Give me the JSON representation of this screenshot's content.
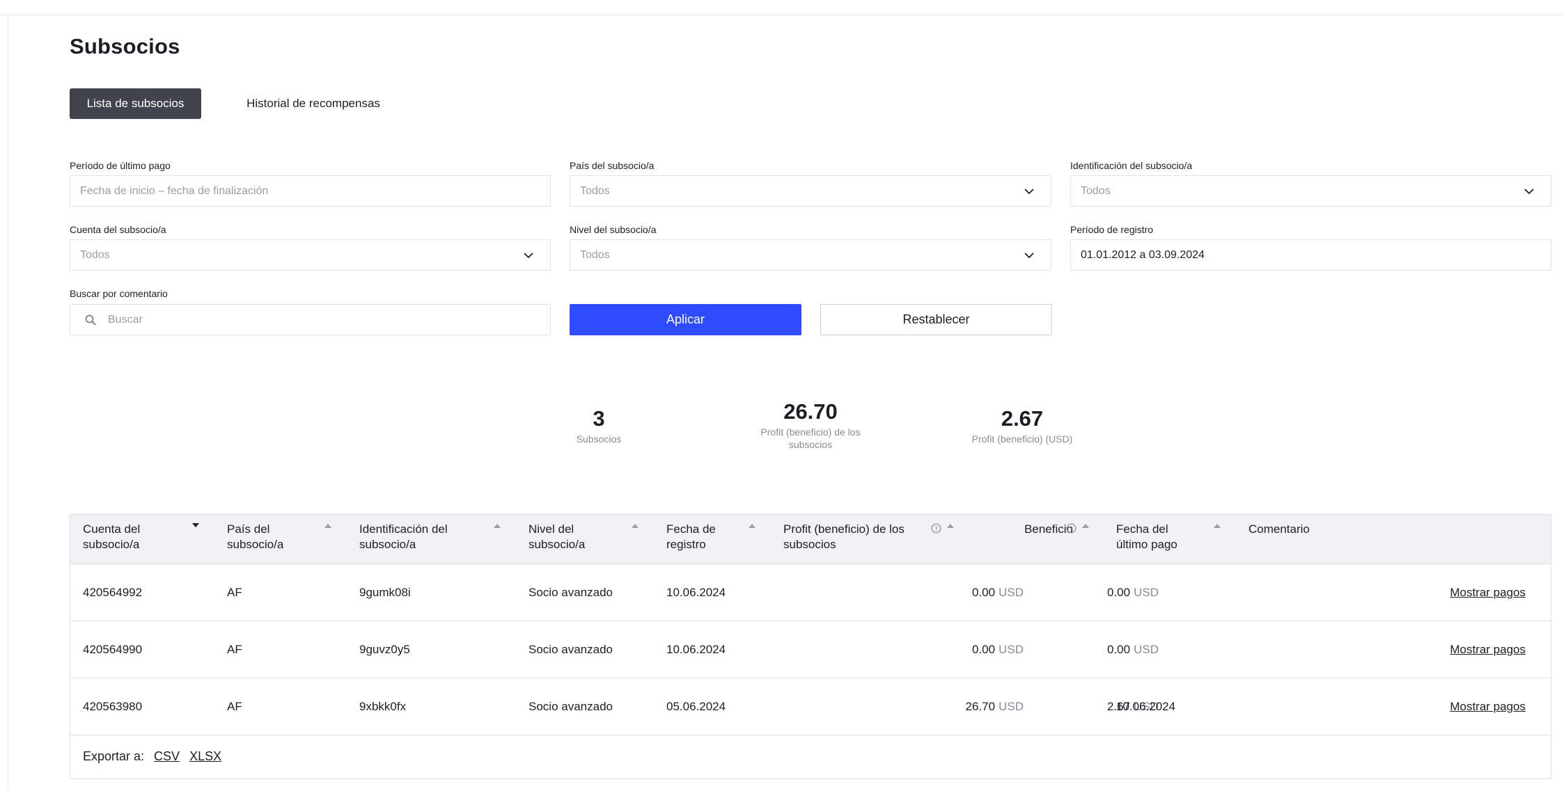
{
  "page": {
    "title": "Subsocios"
  },
  "tabs": [
    {
      "label": "Lista de subsocios",
      "active": true
    },
    {
      "label": "Historial de recompensas",
      "active": false
    }
  ],
  "filters": {
    "last_payment": {
      "label": "Período de último pago",
      "placeholder": "Fecha de inicio – fecha de finalización"
    },
    "country": {
      "label": "País del subsocio/a",
      "value": "Todos"
    },
    "identification": {
      "label": "Identificación del subsocio/a",
      "value": "Todos"
    },
    "account": {
      "label": "Cuenta del subsocio/a",
      "value": "Todos"
    },
    "level": {
      "label": "Nivel del subsocio/a",
      "value": "Todos"
    },
    "registration": {
      "label": "Período de registro",
      "value": "01.01.2012 a 03.09.2024"
    },
    "comment_search": {
      "label": "Buscar por comentario",
      "placeholder": "Buscar"
    }
  },
  "buttons": {
    "apply": "Aplicar",
    "reset": "Restablecer"
  },
  "stats": [
    {
      "value": "3",
      "label": "Subsocios"
    },
    {
      "value": "26.70",
      "label": "Profit (beneficio) de los subsocios"
    },
    {
      "value": "2.67",
      "label": "Profit (beneficio) (USD)"
    }
  ],
  "table": {
    "columns": [
      "Cuenta del subsocio/a",
      "País del subsocio/a",
      "Identificación del subsocio/a",
      "Nivel del subsocio/a",
      "Fecha de registro",
      "Profit (beneficio) de los subsocios",
      "Beneficio",
      "Fecha del último pago",
      "Comentario"
    ],
    "rows": [
      {
        "account": "420564992",
        "country": "AF",
        "id": "9gumk08i",
        "level": "Socio avanzado",
        "registered": "10.06.2024",
        "sub_profit": "0.00",
        "profit": "0.00",
        "last_payment": "",
        "comment": ""
      },
      {
        "account": "420564990",
        "country": "AF",
        "id": "9guvz0y5",
        "level": "Socio avanzado",
        "registered": "10.06.2024",
        "sub_profit": "0.00",
        "profit": "0.00",
        "last_payment": "",
        "comment": ""
      },
      {
        "account": "420563980",
        "country": "AF",
        "id": "9xbkk0fx",
        "level": "Socio avanzado",
        "registered": "05.06.2024",
        "sub_profit": "26.70",
        "profit": "2.67",
        "last_payment": "10.06.2024",
        "comment": ""
      }
    ],
    "currency": "USD",
    "row_action": "Mostrar pagos",
    "export": {
      "label": "Exportar a:",
      "csv": "CSV",
      "xlsx": "XLSX"
    }
  },
  "colors": {
    "primary": "#2f4bff",
    "tab_active": "#43434d",
    "header_bg": "#f2f2f4"
  },
  "icons": [
    "chevron-down-icon",
    "search-icon",
    "sort-desc-icon",
    "sort-asc-icon",
    "help-icon"
  ]
}
